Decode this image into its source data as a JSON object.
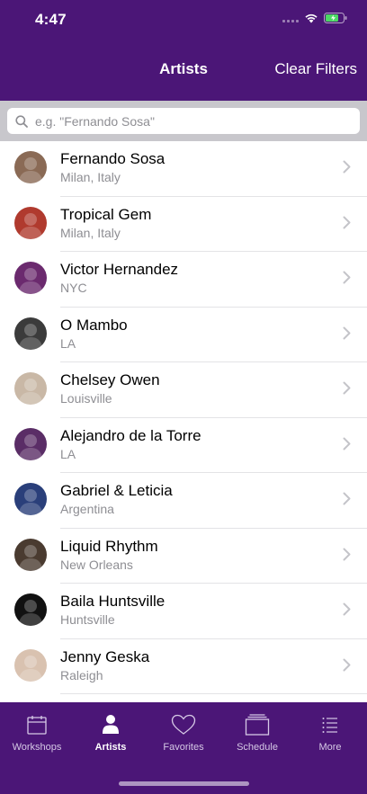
{
  "status": {
    "time": "4:47"
  },
  "nav": {
    "title": "Artists",
    "action": "Clear Filters"
  },
  "search": {
    "placeholder": "e.g. \"Fernando Sosa\""
  },
  "artists": [
    {
      "name": "Fernando Sosa",
      "location": "Milan, Italy",
      "avatar_color": "#8a6a55"
    },
    {
      "name": "Tropical Gem",
      "location": "Milan, Italy",
      "avatar_color": "#b03a2e"
    },
    {
      "name": "Victor Hernandez",
      "location": "NYC",
      "avatar_color": "#6b2a6e"
    },
    {
      "name": "O Mambo",
      "location": "LA",
      "avatar_color": "#3b3b3b"
    },
    {
      "name": "Chelsey Owen",
      "location": "Louisville",
      "avatar_color": "#c9b8a6"
    },
    {
      "name": "Alejandro de la Torre",
      "location": "LA",
      "avatar_color": "#5a2d66"
    },
    {
      "name": "Gabriel & Leticia",
      "location": "Argentina",
      "avatar_color": "#2a3f7a"
    },
    {
      "name": "Liquid Rhythm",
      "location": "New Orleans",
      "avatar_color": "#4a3b30"
    },
    {
      "name": "Baila Huntsville",
      "location": "Huntsville",
      "avatar_color": "#111111"
    },
    {
      "name": "Jenny Geska",
      "location": "Raleigh",
      "avatar_color": "#d9c2b0"
    }
  ],
  "tabs": [
    {
      "label": "Workshops",
      "icon": "calendar-icon",
      "active": false
    },
    {
      "label": "Artists",
      "icon": "person-icon",
      "active": true
    },
    {
      "label": "Favorites",
      "icon": "heart-icon",
      "active": false
    },
    {
      "label": "Schedule",
      "icon": "schedule-icon",
      "active": false
    },
    {
      "label": "More",
      "icon": "list-icon",
      "active": false
    }
  ],
  "colors": {
    "brand": "#4b1677",
    "separator": "#e3e3e6",
    "subtitle": "#8e8e93"
  }
}
